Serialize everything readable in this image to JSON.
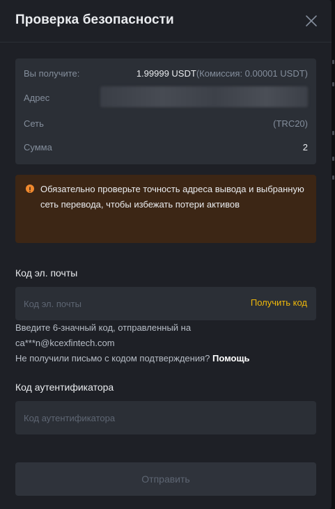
{
  "modal": {
    "title": "Проверка безопасности"
  },
  "summary": {
    "receive_label": "Вы получите:",
    "receive_amount": "1.99999 USDT",
    "receive_fee": "(Комиссия: 0.00001 USDT)",
    "address_label": "Адрес",
    "network_label": "Сеть",
    "network_value": "(TRC20)",
    "sum_label": "Сумма",
    "sum_value": "2"
  },
  "warning": {
    "text": "Обязательно проверьте точность адреса вывода и выбранную сеть перевода, чтобы избежать потери активов"
  },
  "email": {
    "label": "Код эл. почты",
    "placeholder": "Код эл. почты",
    "get_code": "Получить код",
    "hint_line1": "Введите 6-значный код, отправленный на",
    "hint_email": "ca***n@kcexfintech.com",
    "no_email_text": "Не получили письмо с кодом подтверждения?",
    "help_link": "Помощь"
  },
  "authenticator": {
    "label": "Код аутентификатора",
    "placeholder": "Код аутентификатора"
  },
  "submit_label": "Отправить",
  "colors": {
    "background": "#1e2026",
    "panel": "#2b2f36",
    "accent": "#f0b90b",
    "warning_bg": "#3c2615",
    "warning_icon": "#f0892e"
  }
}
